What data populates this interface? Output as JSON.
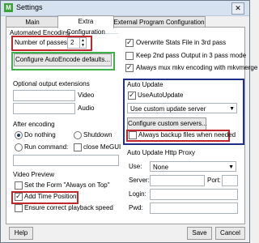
{
  "window": {
    "title": "Settings",
    "app_icon_letter": "M",
    "close_glyph": "✕"
  },
  "tabs": [
    {
      "label": "Main Configuration"
    },
    {
      "label": "Extra Configuration"
    },
    {
      "label": "External Program Configuration"
    }
  ],
  "automated_encoding": {
    "title": "Automated Encoding",
    "passes_label": "Number of passes",
    "passes_value": "2",
    "configure_button": "Configure AutoEncode defaults..."
  },
  "options": {
    "overwrite_stats": "Overwrite Stats File in 3rd pass",
    "keep_2nd_pass": "Keep 2nd pass Output in 3 pass mode",
    "always_mux": "Always mux mkv encoding with mkvmerge"
  },
  "output_extensions": {
    "title": "Optional output extensions",
    "video_label": "Video",
    "audio_label": "Audio",
    "video_value": "",
    "audio_value": ""
  },
  "after_encoding": {
    "title": "After encoding",
    "do_nothing": "Do nothing",
    "shutdown": "Shutdown",
    "run_command": "Run command:",
    "close_megui": "close MeGUI"
  },
  "video_preview": {
    "title": "Video Preview",
    "always_on_top": "Set the Form \"Always on Top\"",
    "add_time_position": "Add Time Position",
    "ensure_speed": "Ensure correct playback speed"
  },
  "auto_update": {
    "title": "Auto Update",
    "use_auto_update": "UseAutoUpdate",
    "server_select": "Use custom update server",
    "configure_servers": "Configure custom servers...",
    "always_backup": "Always backup files when needed"
  },
  "proxy": {
    "title": "Auto Update Http Proxy",
    "use_label": "Use:",
    "use_value": "None",
    "server_label": "Server:",
    "port_label": "Port:",
    "login_label": "Login:",
    "pwd_label": "Pwd:"
  },
  "footer": {
    "help": "Help",
    "save": "Save",
    "cancel": "Cancel"
  },
  "colors": {
    "highlight_red": "#c0272d",
    "highlight_green": "#3db14a",
    "highlight_blue": "#1f2f8c"
  }
}
